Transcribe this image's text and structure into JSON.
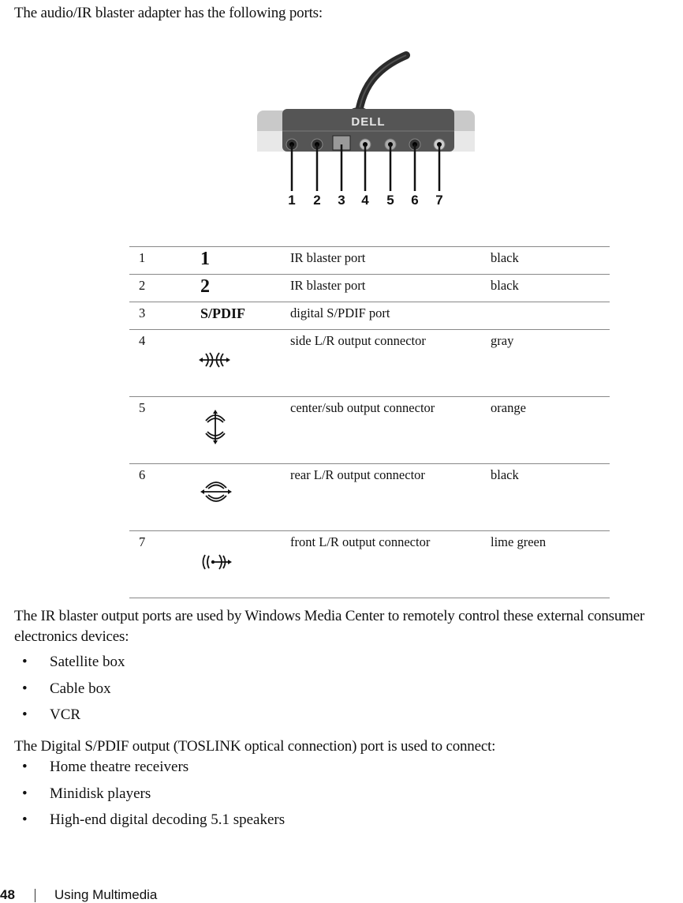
{
  "intro_text": "The audio/IR blaster adapter has the following ports:",
  "figure": {
    "brand": "DELL",
    "callouts": [
      "1",
      "2",
      "3",
      "4",
      "5",
      "6",
      "7"
    ]
  },
  "ports": [
    {
      "num": "1",
      "symbol_text": "1",
      "icon": "",
      "description": "IR blaster port",
      "color": "black"
    },
    {
      "num": "2",
      "symbol_text": "2",
      "icon": "",
      "description": "IR blaster port",
      "color": "black"
    },
    {
      "num": "3",
      "symbol_text": "S/PDIF",
      "icon": "",
      "description": "digital S/PDIF port",
      "color": ""
    },
    {
      "num": "4",
      "symbol_text": "",
      "icon": "side-lr-speaker-icon",
      "description": "side L/R output connector",
      "color": "gray"
    },
    {
      "num": "5",
      "symbol_text": "",
      "icon": "center-sub-speaker-icon",
      "description": "center/sub output connector",
      "color": "orange"
    },
    {
      "num": "6",
      "symbol_text": "",
      "icon": "rear-lr-speaker-icon",
      "description": "rear L/R output connector",
      "color": "black"
    },
    {
      "num": "7",
      "symbol_text": "",
      "icon": "front-lr-speaker-icon",
      "description": "front L/R output connector",
      "color": "lime green"
    }
  ],
  "ir_paragraph": "The IR blaster output ports are used by Windows Media Center to remotely control these external consumer electronics devices:",
  "ir_devices": [
    "Satellite box",
    "Cable box",
    "VCR"
  ],
  "spdif_paragraph": "The Digital S/PDIF output (TOSLINK optical connection) port is used to connect:",
  "spdif_devices": [
    "Home theatre receivers",
    "Minidisk players",
    "High-end digital decoding 5.1 speakers"
  ],
  "footer": {
    "page_number": "48",
    "section": "Using Multimedia"
  }
}
